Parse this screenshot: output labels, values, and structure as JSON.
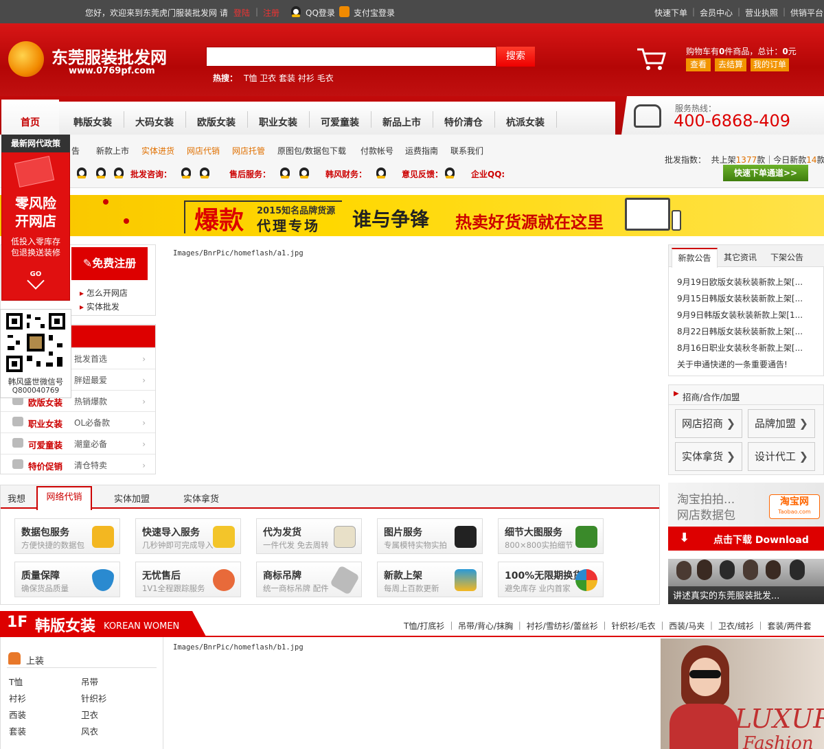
{
  "topbar": {
    "welcome": "您好，欢迎来到东莞虎门服装批发网 请",
    "login": "登陆",
    "register": "注册",
    "qq_login": "QQ登录",
    "alipay_login": "支付宝登录",
    "links": [
      "快速下单",
      "会员中心",
      "营业执照",
      "供销平台"
    ]
  },
  "header": {
    "logo_title": "东莞服装批发网",
    "logo_url": "www.0769pf.com",
    "search_placeholder": "",
    "search_button": "搜索",
    "hot_label": "热搜：",
    "hot_keywords": [
      "T恤",
      "卫衣",
      "套装",
      "衬衫",
      "毛衣"
    ],
    "cart_prefix": "购物车有",
    "cart_count": "0",
    "cart_mid": "件商品，总计：",
    "cart_total": "0",
    "cart_unit": "元",
    "cart_buttons": [
      "查看",
      "去结算",
      "我的订单"
    ]
  },
  "nav": {
    "items": [
      "首页",
      "韩版女装",
      "大码女装",
      "欧版女装",
      "职业女装",
      "可爱童装",
      "新品上市",
      "特价清仓",
      "杭派女装"
    ],
    "hotline_label": "服务热线：",
    "hotline": "400-6868-409"
  },
  "subnav": {
    "links": [
      "告",
      "新款上市",
      "实体进货",
      "网店代销",
      "网店托管",
      "原图包/数据包下载",
      "付款帐号",
      "运费指南",
      "联系我们"
    ],
    "index_label": "批发指数：",
    "index_text1": "共上架",
    "index_count1": "1377",
    "index_text2": "款｜今日新款",
    "index_count2": "14",
    "index_text3": "款",
    "contacts": [
      "批发咨询：",
      "售后服务：",
      "韩风财务：",
      "意见反馈：",
      "企业QQ:"
    ],
    "fast_button": "快速下单通道>>"
  },
  "banner": {
    "big": "爆款",
    "small_top": "2015知名品牌货源",
    "small_bottom": "代理专场",
    "slogan1": "谁与争锋",
    "slogan2": "热卖好货源就在这里"
  },
  "float_ad": {
    "tag": "最新网代政策",
    "title1": "零风险",
    "title2": "开网店",
    "line1": "低投入零库存",
    "line2": "包退换送装修",
    "go": "GO",
    "qr_name": "韩风盛世微信号",
    "qr_id": "Q800040769"
  },
  "left": {
    "register": "免费注册",
    "how1": "怎么开网店",
    "how2": "实体批发",
    "cats": [
      {
        "name": "",
        "desc": "批发首选"
      },
      {
        "name": "",
        "desc": "胖妞最爱"
      },
      {
        "name": "欧版女装",
        "desc": "热销爆款"
      },
      {
        "name": "职业女装",
        "desc": "OL必备款"
      },
      {
        "name": "可爱童装",
        "desc": "潮童必备"
      },
      {
        "name": "特价促销",
        "desc": "清仓特卖"
      }
    ]
  },
  "slide": {
    "img1": "Images/BnrPic/homeflash/a1.jpg",
    "img2": "Images/BnrPic/homeflash/b1.jpg"
  },
  "news": {
    "tabs": [
      "新款公告",
      "其它资讯",
      "下架公告"
    ],
    "items": [
      "9月19日欧版女装秋装新款上架[...",
      "9月15日韩版女装秋装新款上架[...",
      "9月9日韩版女装秋装新款上架[1...",
      "8月22日韩版女装秋装新款上架[...",
      "8月16日职业女装秋冬新款上架[...",
      "关于申通快递的一条重要通告!"
    ]
  },
  "join": {
    "title": "招商/合作/加盟",
    "buttons": [
      "网店招商",
      "品牌加盟",
      "实体拿货",
      "设计代工"
    ]
  },
  "taobao": {
    "line1": "淘宝拍拍...",
    "line2": "网店数据包",
    "brand": "淘宝网",
    "domain": "Taobao.com",
    "download": "点击下载 Download"
  },
  "video": {
    "caption": "讲述真实的东莞服装批发..."
  },
  "svc_tabs": [
    "我想",
    "网络代销",
    "实体加盟",
    "实体拿货"
  ],
  "services": [
    {
      "h": "数据包服务",
      "s": "方便快捷的数据包"
    },
    {
      "h": "快速导入服务",
      "s": "几秒钟即可完成导入"
    },
    {
      "h": "代为发货",
      "s": "一件代发 免去周转"
    },
    {
      "h": "图片服务",
      "s": "专属模特实物实拍"
    },
    {
      "h": "细节大图服务",
      "s": "800×800实拍细节"
    },
    {
      "h": "质量保障",
      "s": "确保货品质量"
    },
    {
      "h": "无忧售后",
      "s": "1V1全程跟踪服务"
    },
    {
      "h": "商标吊牌",
      "s": "统一商标吊牌 配件"
    },
    {
      "h": "新款上架",
      "s": "每周上百款更新"
    },
    {
      "h": "100%无限期换货",
      "s": "避免库存 业内首家"
    }
  ],
  "floor": {
    "num": "1F",
    "title": "韩版女装",
    "en": "KOREAN WOMEN",
    "links": [
      "T恤/打底衫",
      "吊带/背心/抹胸",
      "衬衫/雪纺衫/蕾丝衫",
      "针织衫/毛衣",
      "西装/马夹",
      "卫衣/绒衫",
      "套装/两件套"
    ],
    "side_title": "上装",
    "side_items": [
      "T恤",
      "吊带",
      "衬衫",
      "针织衫",
      "西装",
      "卫衣",
      "套装",
      "风衣"
    ],
    "ad_text1": "LUXUR",
    "ad_text2": "Fashion"
  },
  "colors": {
    "brand_red": "#c40000",
    "accent_orange": "#f29400",
    "nav_green": "#5a9a1a"
  }
}
